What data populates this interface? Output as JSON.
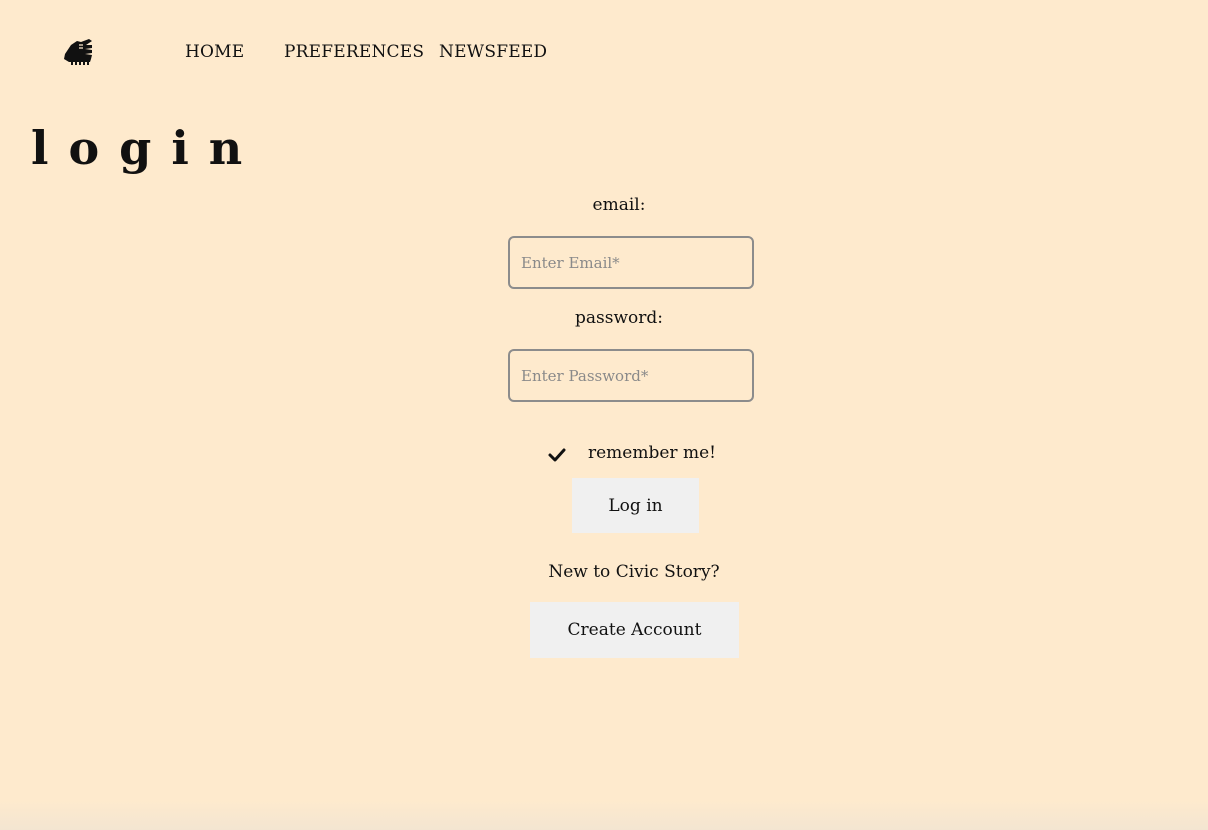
{
  "nav": {
    "logo_icon": "raised-fist-icon",
    "links": [
      {
        "label": "HOME"
      },
      {
        "label": "PREFERENCES"
      },
      {
        "label": "NEWSFEED"
      }
    ]
  },
  "page": {
    "title": "login"
  },
  "form": {
    "email_label": "email:",
    "email_placeholder": "Enter Email*",
    "email_value": "",
    "password_label": "password:",
    "password_placeholder": "Enter Password*",
    "password_value": "",
    "remember_checked": true,
    "remember_label": "remember me!",
    "login_button": "Log in",
    "new_user_text": "New to Civic Story?",
    "create_account_button": "Create Account"
  },
  "colors": {
    "background": "#feeacd",
    "button_bg": "#f0f0f0",
    "input_border": "#8c8c8c"
  }
}
